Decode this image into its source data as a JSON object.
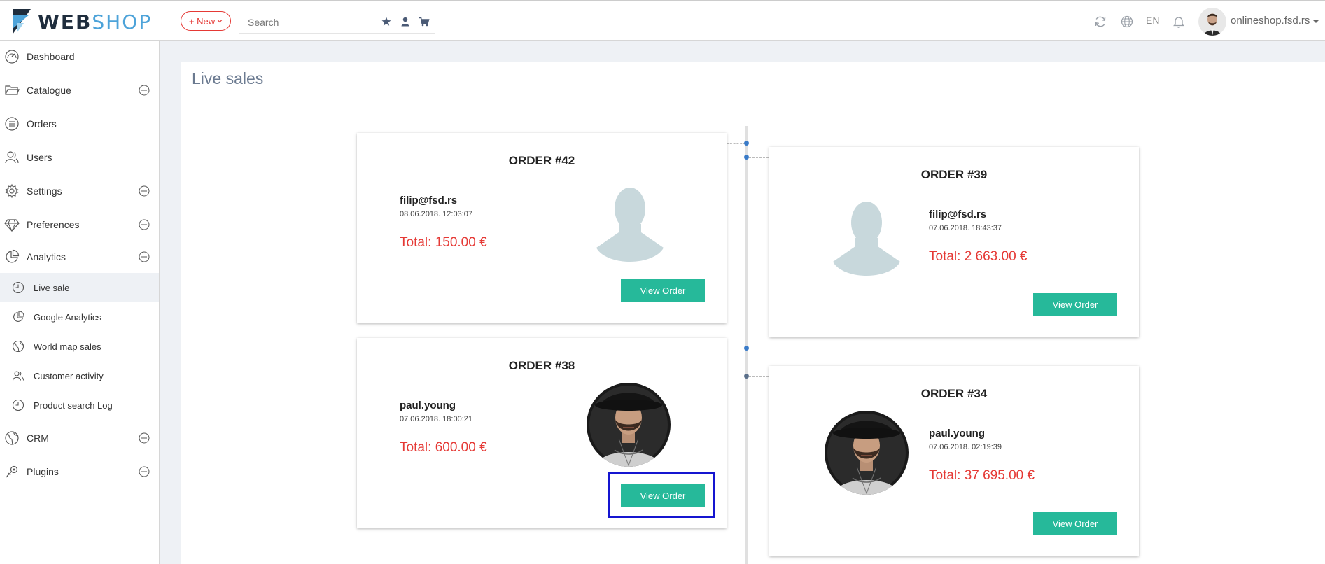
{
  "brand": {
    "name_part1": "WEB",
    "name_part2": "SHOP",
    "accent": "#4da3d9"
  },
  "header": {
    "new_label": "+ New",
    "search_placeholder": "Search",
    "search_icons": [
      "star-icon",
      "user-icon",
      "cart-icon"
    ],
    "right_icons": [
      "refresh-icon",
      "globe-icon",
      "bell-icon"
    ],
    "language": "EN",
    "account": "onlineshop.fsd.rs"
  },
  "sidebar": {
    "items": [
      {
        "label": "Dashboard",
        "icon": "dashboard-icon"
      },
      {
        "label": "Catalogue",
        "icon": "folder-icon",
        "expandable": true
      },
      {
        "label": "Orders",
        "icon": "list-icon"
      },
      {
        "label": "Users",
        "icon": "users-icon"
      },
      {
        "label": "Settings",
        "icon": "gear-icon",
        "expandable": true
      },
      {
        "label": "Preferences",
        "icon": "diamond-icon",
        "expandable": true
      },
      {
        "label": "Analytics",
        "icon": "pie-chart-icon",
        "expanded": true
      }
    ],
    "analytics_sub": [
      {
        "label": "Live sale",
        "icon": "clock-icon",
        "active": true
      },
      {
        "label": "Google Analytics",
        "icon": "pie-chart-icon"
      },
      {
        "label": "World map sales",
        "icon": "globe-icon"
      },
      {
        "label": "Customer activity",
        "icon": "users-icon"
      },
      {
        "label": "Product search Log",
        "icon": "clock-icon"
      }
    ],
    "items_after": [
      {
        "label": "CRM",
        "icon": "globe-icon",
        "expandable": true
      },
      {
        "label": "Plugins",
        "icon": "plug-icon",
        "expandable": true
      }
    ]
  },
  "page": {
    "title": "Live sales"
  },
  "orders": [
    {
      "title": "ORDER #42",
      "customer": "filip@fsd.rs",
      "date": "08.06.2018. 12:03:07",
      "total": "Total: 150.00 €",
      "button": "View Order",
      "avatar": "silhouette-icon"
    },
    {
      "title": "ORDER #39",
      "customer": "filip@fsd.rs",
      "date": "07.06.2018. 18:43:37",
      "total": "Total: 2 663.00 €",
      "button": "View Order",
      "avatar": "silhouette-icon"
    },
    {
      "title": "ORDER #38",
      "customer": "paul.young",
      "date": "07.06.2018. 18:00:21",
      "total": "Total: 600.00 €",
      "button": "View Order",
      "avatar": "customer-photo"
    },
    {
      "title": "ORDER #34",
      "customer": "paul.young",
      "date": "07.06.2018. 02:19:39",
      "total": "Total: 37 695.00 €",
      "button": "View Order",
      "avatar": "customer-photo"
    }
  ],
  "colors": {
    "button": "#26b99a",
    "total": "#e53935",
    "timeline_dot": "#3a7bc8"
  }
}
